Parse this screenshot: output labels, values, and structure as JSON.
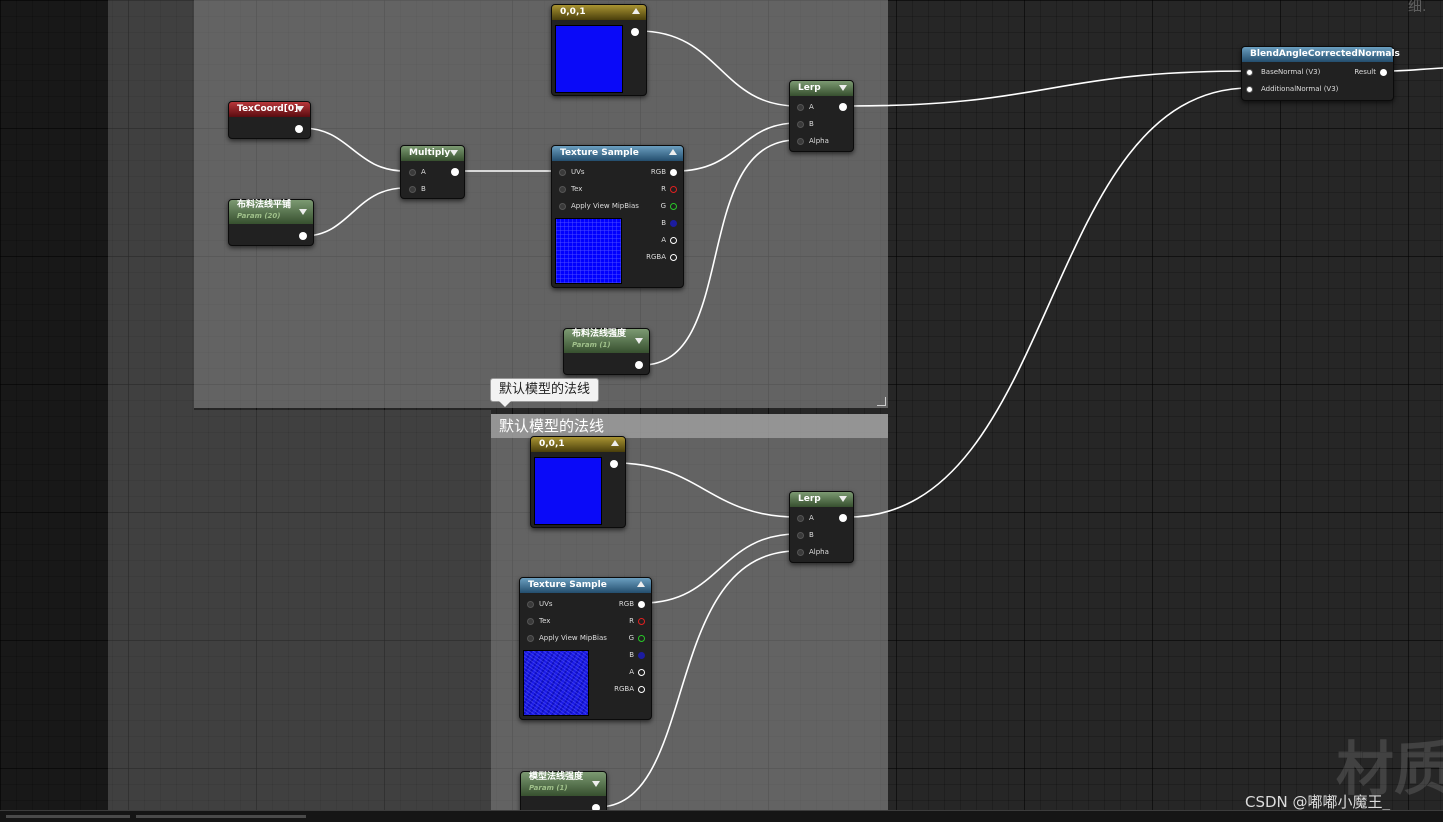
{
  "comments": {
    "default_normal_title": "默认模型的法线"
  },
  "tooltip": {
    "text": "默认模型的法线"
  },
  "nodes": {
    "const_top": {
      "title": "0,0,1"
    },
    "texcoord": {
      "title": "TexCoord[0]"
    },
    "multiply": {
      "title": "Multiply",
      "pins": [
        "A",
        "B"
      ]
    },
    "fabric_tiling": {
      "title": "布料法线平铺",
      "subtitle": "Param (20)"
    },
    "texture_top": {
      "title": "Texture Sample",
      "inputs": [
        "UVs",
        "Tex",
        "Apply View MipBias"
      ],
      "outputs": [
        "RGB",
        "R",
        "G",
        "B",
        "A",
        "RGBA"
      ]
    },
    "fabric_strength": {
      "title": "布料法线强度",
      "subtitle": "Param (1)"
    },
    "lerp_top": {
      "title": "Lerp",
      "pins": [
        "A",
        "B",
        "Alpha"
      ]
    },
    "blend": {
      "title": "BlendAngleCorrectedNormals",
      "inputs": [
        "BaseNormal (V3)",
        "AdditionalNormal (V3)"
      ],
      "output": "Result"
    },
    "const_bottom": {
      "title": "0,0,1"
    },
    "texture_bottom": {
      "title": "Texture Sample",
      "inputs": [
        "UVs",
        "Tex",
        "Apply View MipBias"
      ],
      "outputs": [
        "RGB",
        "R",
        "G",
        "B",
        "A",
        "RGBA"
      ]
    },
    "lerp_bottom": {
      "title": "Lerp",
      "pins": [
        "A",
        "B",
        "Alpha"
      ]
    },
    "model_strength": {
      "title": "模型法线强度",
      "subtitle": "Param (1)"
    }
  },
  "watermark": {
    "text": "材质"
  },
  "corner_label": {
    "text": "细.⁠"
  },
  "credit": {
    "text": "CSDN @嘟嘟小魔王_"
  },
  "colors": {
    "swatch": "#0a0af8",
    "background": "#262626",
    "wire": "#ffffff"
  }
}
